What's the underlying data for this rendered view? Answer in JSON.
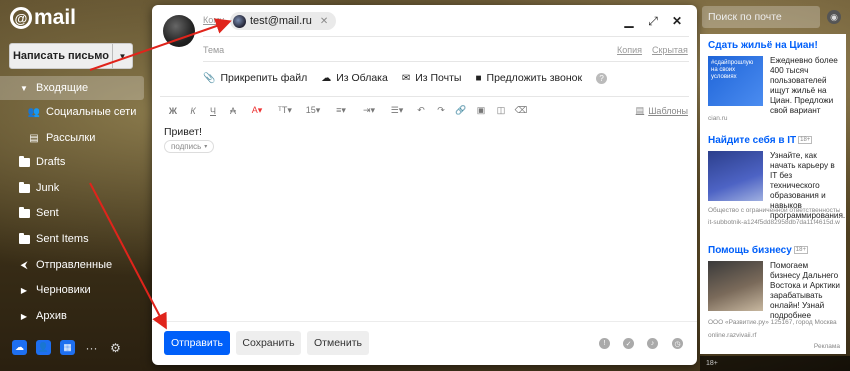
{
  "logo": {
    "at": "@",
    "text": "mail"
  },
  "sidebar": {
    "compose_label": "Написать письмо",
    "items": [
      {
        "label": "Входящие",
        "icon": "chevron-down-icon"
      },
      {
        "label": "Социальные сети",
        "icon": "people-icon"
      },
      {
        "label": "Рассылки",
        "icon": "newsletter-icon"
      },
      {
        "label": "Drafts",
        "icon": "folder-icon"
      },
      {
        "label": "Junk",
        "icon": "folder-icon"
      },
      {
        "label": "Sent",
        "icon": "folder-icon"
      },
      {
        "label": "Sent Items",
        "icon": "folder-icon"
      },
      {
        "label": "Отправленные",
        "icon": "send-icon"
      },
      {
        "label": "Черновики",
        "icon": "chevron-right-icon"
      },
      {
        "label": "Архив",
        "icon": "chevron-right-icon"
      }
    ],
    "bottom_more": "···"
  },
  "compose": {
    "to_label": "Кому",
    "recipient": "test@mail.ru",
    "subject_label": "Тема",
    "cc_label": "Копия",
    "bcc_label": "Скрытая",
    "attach": {
      "file": "Прикрепить файл",
      "cloud": "Из Облака",
      "mail": "Из Почты",
      "call": "Предложить звонок"
    },
    "toolbar": {
      "bold": "Ж",
      "italic": "К",
      "underline": "Ч",
      "font_size": "15",
      "templates": "Шаблоны"
    },
    "body_text": "Привет!",
    "signature": "подпись",
    "buttons": {
      "send": "Отправить",
      "save": "Сохранить",
      "cancel": "Отменить"
    }
  },
  "search": {
    "placeholder": "Поиск по почте"
  },
  "ads": [
    {
      "title": "Сдать жильё на Циан!",
      "text": "Ежедневно более 400 тысяч пользователей ищут жильё на Циан. Предложи свой вариант",
      "source": "cian.ru",
      "img_text": "#сдайпрошлую на своих условиях"
    },
    {
      "title": "Найдите себя в IT",
      "age": "18+",
      "text": "Узнайте, как начать карьеру в IT без технического образования и навыков программирования.",
      "legal": "Общество с ограниченной ответственностью",
      "source": "it-subbotnik-a124f5dd82958db7da11f4615d.webflow.io"
    },
    {
      "title": "Помощь бизнесу",
      "age": "18+",
      "text": "Помогаем бизнесу Дальнего Востока и Арктики зарабатывать онлайн! Узнай подробнее",
      "legal": "ООО «Развитие.ру» 125167, город Москва",
      "source": "online.razvivaii.rf"
    }
  ],
  "ad_label": "Реклама",
  "bottom_strip": "18+",
  "colors": {
    "send": "#005ff9",
    "link": "#005ff9",
    "arrow": "#e0241b"
  }
}
